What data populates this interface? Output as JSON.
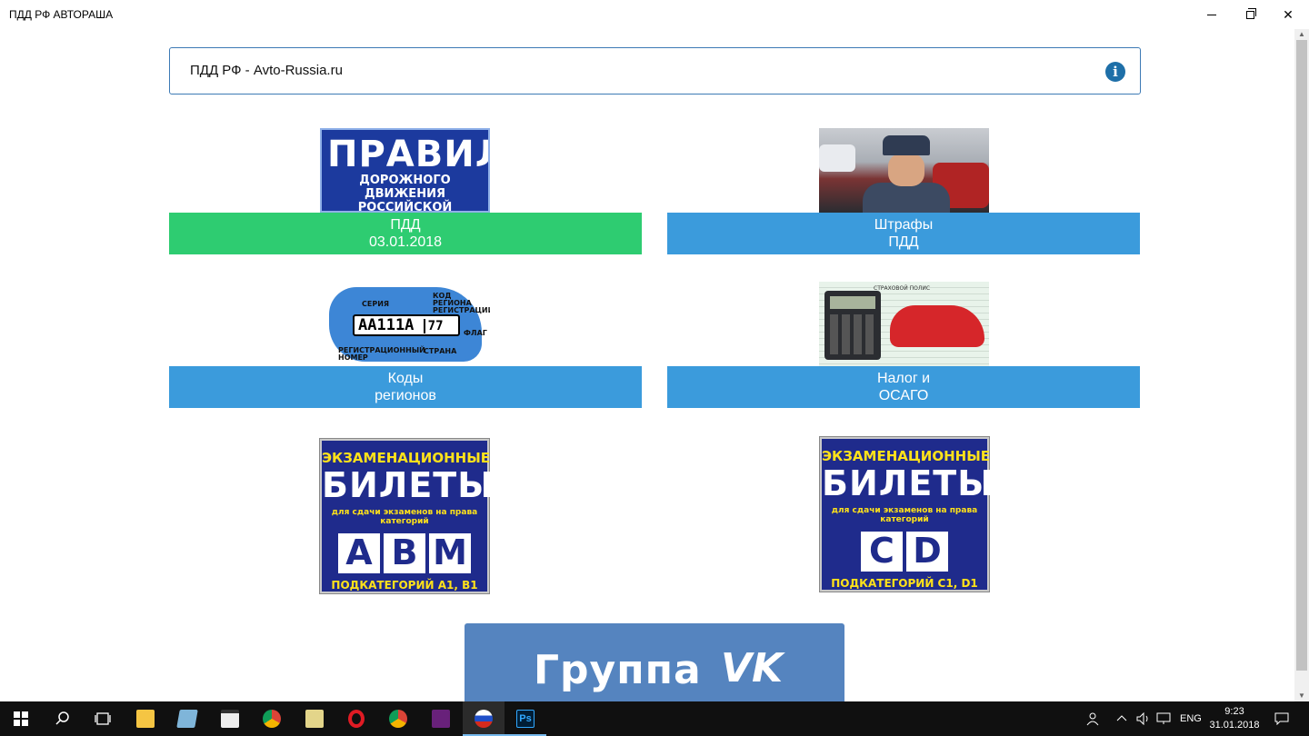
{
  "window": {
    "title": "ПДД РФ АВТОРАША"
  },
  "header": {
    "text": "ПДД РФ - Avto-Russia.ru",
    "info_icon": "info-icon"
  },
  "tiles": [
    {
      "line1": "ПДД",
      "line2": "03.01.2018",
      "image_text_big": "ПРАВИЛА",
      "image_text_small1": "ДОРОЖНОГО ДВИЖЕНИЯ",
      "image_text_small2": "РОССИЙСКОЙ ФЕДЕРАЦИИ",
      "color": "#2ecc71"
    },
    {
      "line1": "Штрафы",
      "line2": "ПДД",
      "color": "#3b9bdc"
    },
    {
      "line1": "Коды",
      "line2": "регионов",
      "plate": "АА111А",
      "region": "77",
      "lbl_series": "СЕРИЯ",
      "lbl_code": "КОД РЕГИОНА РЕГИСТРАЦИИ",
      "lbl_flag": "ФЛАГ",
      "lbl_number": "РЕГИСТРАЦИОННЫЙ НОМЕР",
      "lbl_country": "СТРАНА",
      "color": "#3b9bdc"
    },
    {
      "line1": "Налог и",
      "line2": "ОСАГО",
      "doc_title": "СТРАХОВОЙ ПОЛИС",
      "color": "#3b9bdc"
    }
  ],
  "tickets": [
    {
      "t1": "ЭКЗАМЕНАЦИОННЫЕ",
      "t2": "БИЛЕТЫ",
      "t3a": "для сдачи экзаменов на права",
      "t3b": "категорий",
      "cats": [
        "A",
        "B",
        "M"
      ],
      "sub": "ПОДКАТЕГОРИЙ А1, В1"
    },
    {
      "t1": "ЭКЗАМЕНАЦИОННЫЕ",
      "t2": "БИЛЕТЫ",
      "t3a": "для сдачи экзаменов на права",
      "t3b": "категорий",
      "cats": [
        "C",
        "D"
      ],
      "sub": "ПОДКАТЕГОРИЙ С1, D1"
    }
  ],
  "vk": {
    "text": "Группа",
    "logo": "VK"
  },
  "taskbar": {
    "lang": "ENG",
    "time": "9:23",
    "date": "31.01.2018",
    "ps_label": "Ps"
  },
  "colors": {
    "accent_blue": "#3b9bdc",
    "accent_green": "#2ecc71",
    "header_border": "#3d7ab5",
    "vk_blue": "#5584bf"
  }
}
